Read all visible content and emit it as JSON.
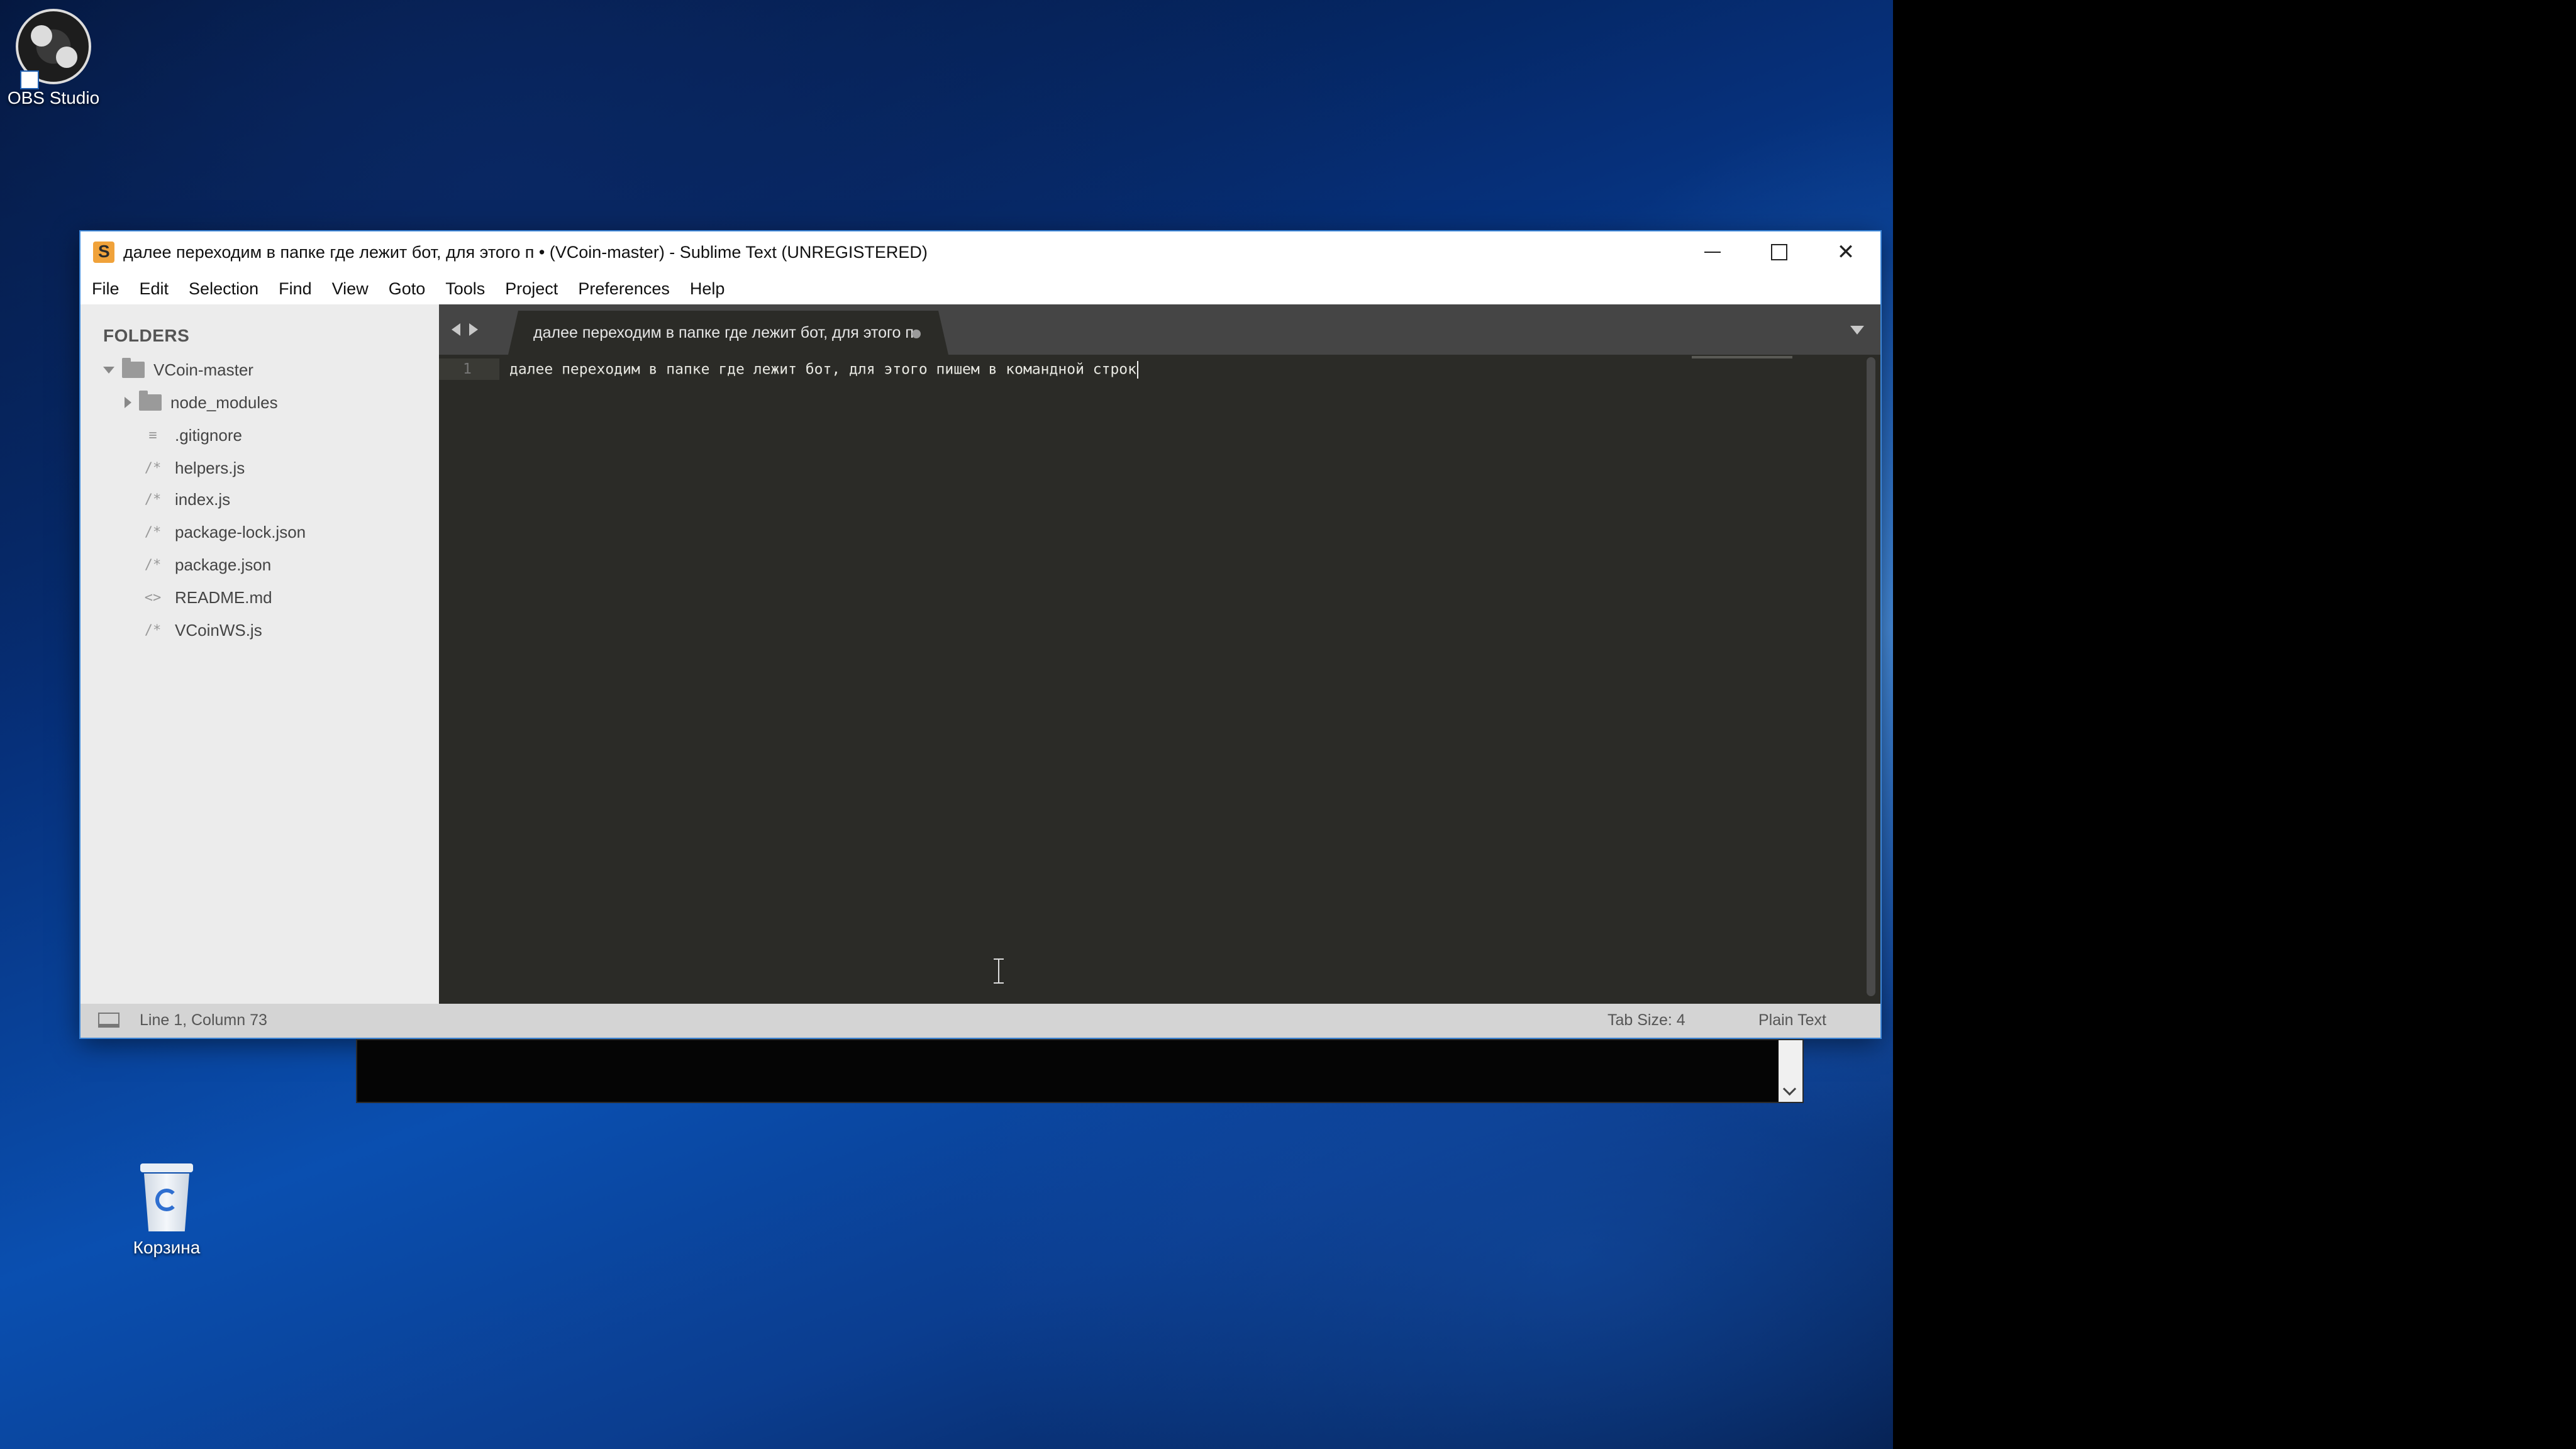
{
  "desktop": {
    "icons": [
      {
        "label": "OBS Studio"
      },
      {
        "label": "Корзина"
      }
    ]
  },
  "window": {
    "title": "далее переходим в папке где лежит бот, для этого п • (VCoin-master) - Sublime Text (UNREGISTERED)",
    "controls": {
      "minimize": "minimize-icon",
      "maximize": "maximize-icon",
      "close": "✕"
    }
  },
  "menu": {
    "items": [
      "File",
      "Edit",
      "Selection",
      "Find",
      "View",
      "Goto",
      "Tools",
      "Project",
      "Preferences",
      "Help"
    ]
  },
  "sidebar": {
    "heading": "FOLDERS",
    "root": "VCoin-master",
    "items": [
      {
        "name": "node_modules",
        "type": "folder",
        "icon": "≡"
      },
      {
        "name": ".gitignore",
        "type": "file",
        "icon": "≡"
      },
      {
        "name": "helpers.js",
        "type": "file",
        "icon": "/*"
      },
      {
        "name": "index.js",
        "type": "file",
        "icon": "/*"
      },
      {
        "name": "package-lock.json",
        "type": "file",
        "icon": "/*"
      },
      {
        "name": "package.json",
        "type": "file",
        "icon": "/*"
      },
      {
        "name": "README.md",
        "type": "file",
        "icon": "<>"
      },
      {
        "name": "VCoinWS.js",
        "type": "file",
        "icon": "/*"
      }
    ]
  },
  "editor": {
    "tab_label": "далее переходим в папке где лежит бот, для этого п",
    "line_number": "1",
    "code": "далее переходим в папке где лежит бот, для этого пишем в командной строк"
  },
  "status": {
    "position": "Line 1, Column 73",
    "tab_size": "Tab Size: 4",
    "syntax": "Plain Text"
  }
}
